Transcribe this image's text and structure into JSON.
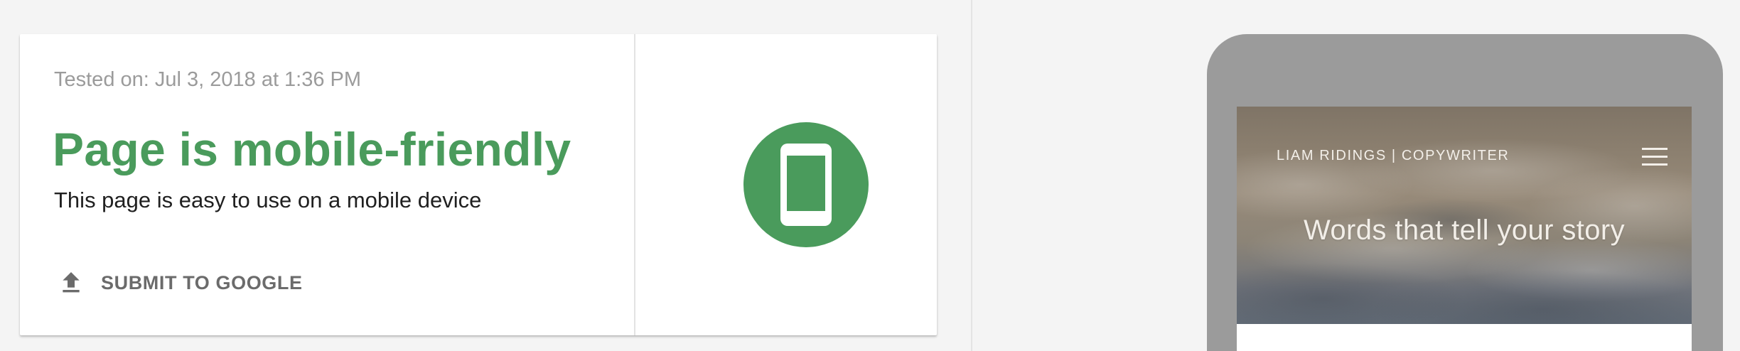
{
  "result": {
    "tested_on": "Tested on: Jul 3, 2018 at 1:36 PM",
    "verdict": "Page is mobile-friendly",
    "description": "This page is easy to use on a mobile device",
    "submit_label": "SUBMIT TO GOOGLE",
    "status_color": "#4a9b5c"
  },
  "icons": {
    "submit": "upload-icon",
    "status": "mobile-phone-icon",
    "menu": "hamburger-menu-icon"
  },
  "preview": {
    "site_title": "LIAM RIDINGS | COPYWRITER",
    "tagline": "Words that tell your story",
    "frame_color": "#9b9b9b"
  }
}
